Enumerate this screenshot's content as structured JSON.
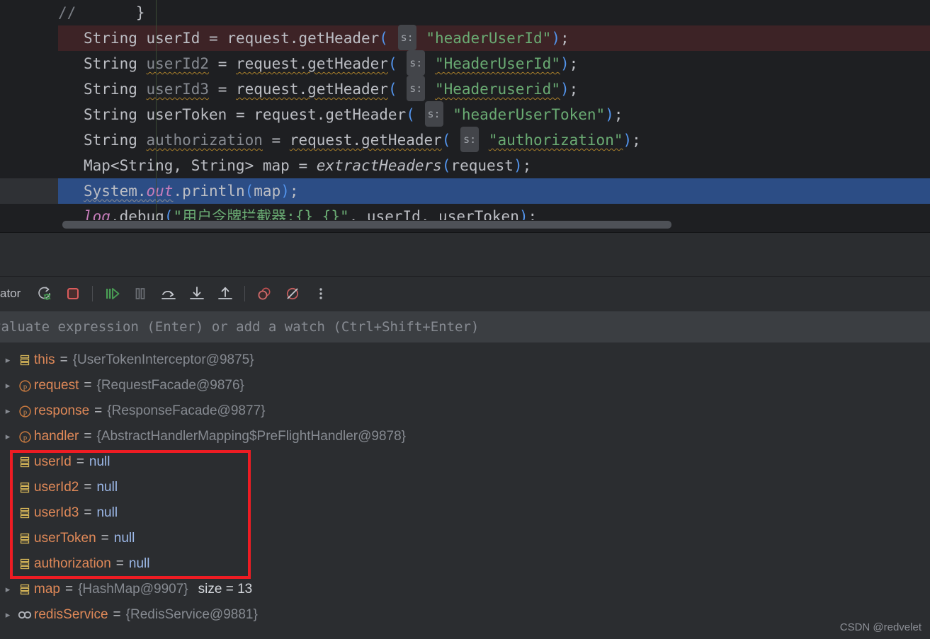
{
  "editor": {
    "lines": [
      {
        "id": "l1",
        "state": "normal",
        "kind": "comment_brace"
      },
      {
        "id": "l2",
        "state": "breakpoint",
        "kind": "decl_header",
        "type": "String",
        "var": "userId",
        "call": "request.getHeader",
        "hint": "s:",
        "arg": "\"headerUserId\"",
        "var_warn": false,
        "call_warn": false,
        "arg_warn": false
      },
      {
        "id": "l3",
        "state": "normal",
        "kind": "decl_header",
        "type": "String",
        "var": "userId2",
        "call": "request.getHeader",
        "hint": "s:",
        "arg": "\"HeaderUserId\"",
        "var_warn": true,
        "call_warn": true,
        "arg_warn": true
      },
      {
        "id": "l4",
        "state": "normal",
        "kind": "decl_header",
        "type": "String",
        "var": "userId3",
        "call": "request.getHeader",
        "hint": "s:",
        "arg": "\"Headeruserid\"",
        "var_warn": true,
        "call_warn": true,
        "arg_warn": true
      },
      {
        "id": "l5",
        "state": "normal",
        "kind": "decl_header",
        "type": "String",
        "var": "userToken",
        "call": "request.getHeader",
        "hint": "s:",
        "arg": "\"headerUserToken\"",
        "var_warn": false,
        "call_warn": false,
        "arg_warn": false
      },
      {
        "id": "l6",
        "state": "normal",
        "kind": "decl_header",
        "type": "String",
        "var": "authorization",
        "call": "request.getHeader",
        "hint": "s:",
        "arg": "\"authorization\"",
        "var_warn": true,
        "call_warn": true,
        "arg_warn": true
      },
      {
        "id": "l7",
        "state": "normal",
        "kind": "map_decl",
        "generic": "Map<String, String>",
        "var": "map",
        "call": "extractHeaders",
        "arg": "request"
      },
      {
        "id": "l8",
        "state": "executing",
        "kind": "println",
        "obj": "System",
        "field": "out",
        "method": "println",
        "arg": "map"
      },
      {
        "id": "l9",
        "state": "normal",
        "kind": "logdebug",
        "logger": "log",
        "method": "debug",
        "fmt": "\"用户令牌拦截器:{} {}\"",
        "args": ", userId, userToken"
      }
    ],
    "comment": "//",
    "closing_brace": "}",
    "scrollbar": "horizontal-scrollbar"
  },
  "toolbar": {
    "tab_label_visible": "ator",
    "buttons": [
      {
        "name": "rerun-button",
        "tooltip": "Rerun"
      },
      {
        "name": "stop-button",
        "tooltip": "Stop"
      },
      {
        "name": "resume-program-button",
        "tooltip": "Resume Program"
      },
      {
        "name": "pause-program-button",
        "tooltip": "Pause Program"
      },
      {
        "name": "step-over-button",
        "tooltip": "Step Over"
      },
      {
        "name": "step-into-button",
        "tooltip": "Step Into"
      },
      {
        "name": "step-out-button",
        "tooltip": "Step Out"
      },
      {
        "name": "view-breakpoints-button",
        "tooltip": "View Breakpoints"
      },
      {
        "name": "mute-breakpoints-button",
        "tooltip": "Mute Breakpoints"
      },
      {
        "name": "more-options-button",
        "tooltip": "More"
      }
    ]
  },
  "evaluate": {
    "placeholder": "valuate expression (Enter) or add a watch (Ctrl+Shift+Enter)"
  },
  "variables": [
    {
      "icon": "local-variable-icon",
      "twisty": true,
      "name": "this",
      "value": "{UserTokenInterceptor@9875}",
      "extra": "",
      "highlighted": false
    },
    {
      "icon": "parameter-icon",
      "twisty": true,
      "name": "request",
      "value": "{RequestFacade@9876}",
      "extra": "",
      "highlighted": false
    },
    {
      "icon": "parameter-icon",
      "twisty": true,
      "name": "response",
      "value": "{ResponseFacade@9877}",
      "extra": "",
      "highlighted": false
    },
    {
      "icon": "parameter-icon",
      "twisty": true,
      "name": "handler",
      "value": "{AbstractHandlerMapping$PreFlightHandler@9878}",
      "extra": "",
      "highlighted": false
    },
    {
      "icon": "local-variable-icon",
      "twisty": false,
      "name": "userId",
      "value": "null",
      "extra": "",
      "highlighted": true
    },
    {
      "icon": "local-variable-icon",
      "twisty": false,
      "name": "userId2",
      "value": "null",
      "extra": "",
      "highlighted": true
    },
    {
      "icon": "local-variable-icon",
      "twisty": false,
      "name": "userId3",
      "value": "null",
      "extra": "",
      "highlighted": true
    },
    {
      "icon": "local-variable-icon",
      "twisty": false,
      "name": "userToken",
      "value": "null",
      "extra": "",
      "highlighted": true
    },
    {
      "icon": "local-variable-icon",
      "twisty": false,
      "name": "authorization",
      "value": "null",
      "extra": "",
      "highlighted": true
    },
    {
      "icon": "local-variable-icon",
      "twisty": true,
      "name": "map",
      "value": "{HashMap@9907}",
      "extra": "size = 13",
      "highlighted": false
    },
    {
      "icon": "field-icon",
      "twisty": true,
      "name": "redisService",
      "value": "{RedisService@9881}",
      "extra": "",
      "highlighted": false
    }
  ],
  "watermark": "CSDN @redvelet",
  "colors": {
    "editor_bg": "#1e1f22",
    "panel_bg": "#2b2d30",
    "breakpoint_line": "#3d2326",
    "exec_line": "#2c4d85",
    "string_green": "#6aab73",
    "var_orange": "#e08958",
    "null_blue": "#9cb8e8",
    "highlight_box": "#ee1c23",
    "eval_bar_bg": "#3b3e42"
  }
}
